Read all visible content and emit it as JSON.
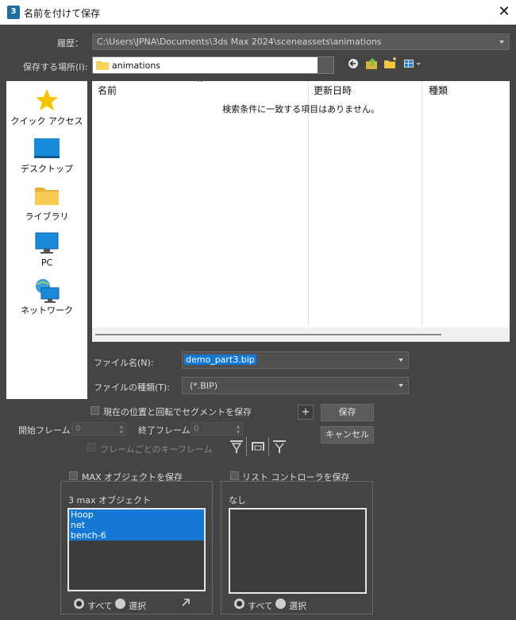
{
  "window": {
    "title": "名前を付けて保存",
    "app_icon_text": "3",
    "close_glyph": "✕"
  },
  "history": {
    "label": "履歴：",
    "value": "C:\\Users\\JPNA\\Documents\\3ds Max 2024\\sceneassets\\animations"
  },
  "save_in": {
    "label": "保存する場所(I):",
    "value": "animations"
  },
  "toolbar": {
    "icons": [
      "back-icon",
      "up-folder-icon",
      "new-folder-icon",
      "view-menu-icon"
    ]
  },
  "places": [
    {
      "label": "クイック アクセス",
      "icon": "star-icon"
    },
    {
      "label": "デスクトップ",
      "icon": "desktop-icon"
    },
    {
      "label": "ライブラリ",
      "icon": "library-folder-icon"
    },
    {
      "label": "PC",
      "icon": "pc-icon"
    },
    {
      "label": "ネットワーク",
      "icon": "network-icon"
    }
  ],
  "file_list": {
    "columns": [
      "名前",
      "更新日時",
      "種類"
    ],
    "empty_message": "検索条件に一致する項目はありません。"
  },
  "file_name": {
    "label": "ファイル名(N):",
    "value": "demo_part3.bip"
  },
  "file_type": {
    "label": "ファイルの種類(T):",
    "value": "(*.BIP)"
  },
  "options": {
    "save_segment_label": "現在の位置と回転でセグメントを保存",
    "plus_label": "+",
    "start_frame_label": "開始フレーム：",
    "start_frame_value": "0",
    "end_frame_label": "終了フレーム：",
    "end_frame_value": "0",
    "keys_per_frame_label": "フレームごとのキーフレーム"
  },
  "buttons": {
    "save": "保存",
    "cancel": "キャンセル"
  },
  "max_objects": {
    "checkbox_label": "MAX オブジェクトを保存",
    "title": "3 max オブジェクト",
    "items": [
      "Hoop",
      "net",
      "bench-6"
    ],
    "radio_all": "すべて",
    "radio_select": "選択"
  },
  "list_controllers": {
    "checkbox_label": "リスト コントローラを保存",
    "title": "なし",
    "radio_all": "すべて",
    "radio_select": "選択"
  },
  "colors": {
    "background": "#444444",
    "selection": "#1478d4",
    "folder": "#f5c542"
  }
}
